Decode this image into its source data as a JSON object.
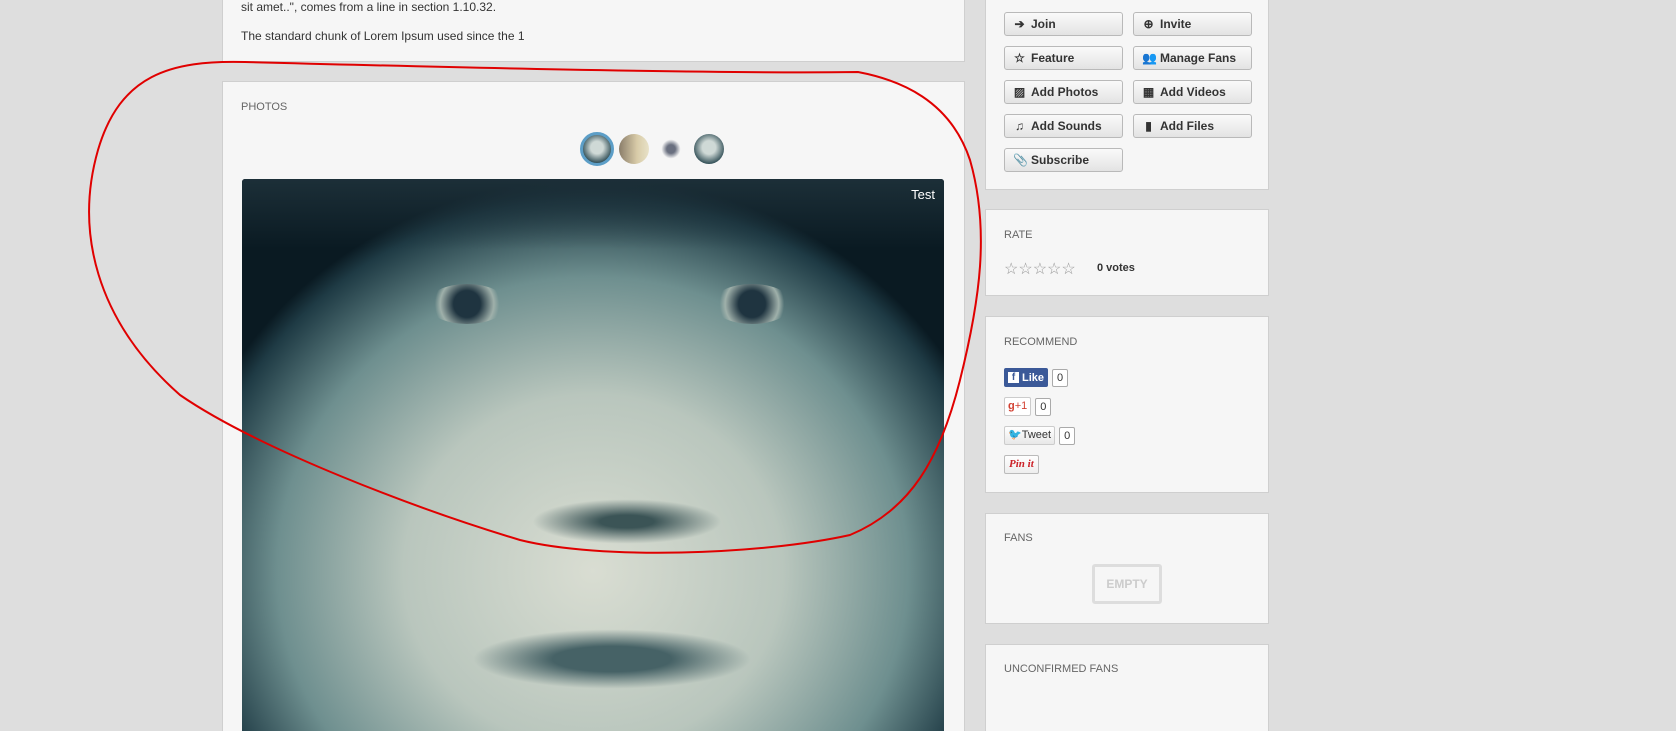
{
  "article": {
    "line1": "sit amet..\", comes from a line in section 1.10.32.",
    "line2": "The standard chunk of Lorem Ipsum used since the 1"
  },
  "photos": {
    "title": "PHOTOS",
    "caption": "Test",
    "thumbnails": 4
  },
  "actions": [
    {
      "label": "Join",
      "icon": "join-icon",
      "glyph": "➔"
    },
    {
      "label": "Invite",
      "icon": "plus-circle-icon",
      "glyph": "⊕"
    },
    {
      "label": "Feature",
      "icon": "star-icon",
      "glyph": "☆"
    },
    {
      "label": "Manage Fans",
      "icon": "group-icon",
      "glyph": "👥"
    },
    {
      "label": "Add Photos",
      "icon": "picture-icon",
      "glyph": "▨"
    },
    {
      "label": "Add Videos",
      "icon": "film-icon",
      "glyph": "▦"
    },
    {
      "label": "Add Sounds",
      "icon": "music-icon",
      "glyph": "♫"
    },
    {
      "label": "Add Files",
      "icon": "floppy-icon",
      "glyph": "▮"
    },
    {
      "label": "Subscribe",
      "icon": "paperclip-icon",
      "glyph": "📎"
    }
  ],
  "rate": {
    "title": "RATE",
    "stars": "☆☆☆☆☆",
    "rating": 0,
    "votes": "0 votes"
  },
  "recommend": {
    "title": "RECOMMEND",
    "like": "Like",
    "like_count": "0",
    "gplus": "+1",
    "gplus_count": "0",
    "tweet": "Tweet",
    "tweet_count": "0",
    "pin": "Pin it"
  },
  "fans": {
    "title": "FANS",
    "empty": "EMPTY"
  },
  "unconfirmed": {
    "title": "UNCONFIRMED FANS"
  },
  "colors": {
    "annotation": "#e00000",
    "facebook": "#3b5998",
    "twitter": "#2aa3e0",
    "pinterest": "#cb2027"
  }
}
